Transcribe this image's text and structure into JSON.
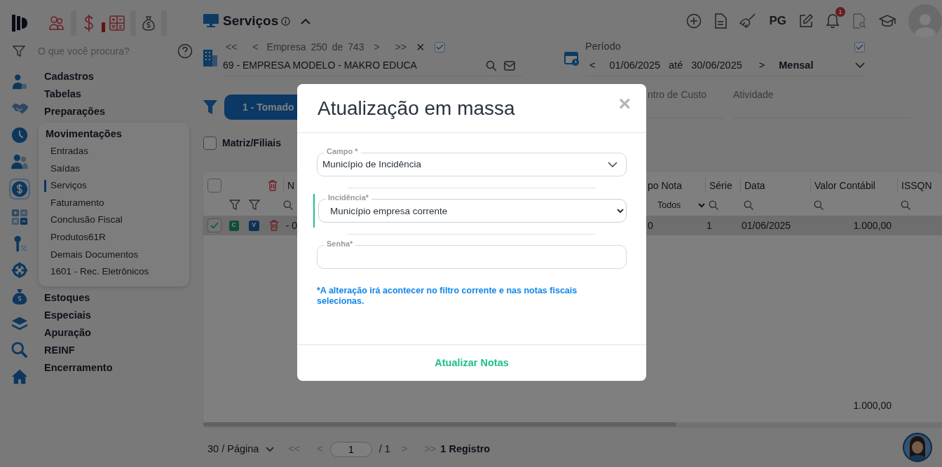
{
  "sidebar": {
    "search": {
      "placeholder": "O que você procura?"
    },
    "rail": [
      {
        "selected": false
      },
      {
        "selected": false
      },
      {
        "selected": false
      },
      {
        "selected": false
      },
      {
        "selected": true
      },
      {
        "selected": false
      },
      {
        "selected": false
      },
      {
        "selected": false
      },
      {
        "selected": false
      },
      {
        "selected": false
      },
      {
        "selected": false
      },
      {
        "selected": false
      }
    ],
    "menu": [
      {
        "label": "Cadastros",
        "expanded": false
      },
      {
        "label": "Tabelas",
        "expanded": false
      },
      {
        "label": "Preparações",
        "expanded": false
      },
      {
        "label": "Movimentações",
        "expanded": true,
        "children": [
          {
            "label": "Entradas",
            "selected": false
          },
          {
            "label": "Saídas",
            "selected": false
          },
          {
            "label": "Serviços",
            "selected": true
          },
          {
            "label": "Faturamento",
            "selected": false
          },
          {
            "label": "Conclusão Fiscal",
            "selected": false
          },
          {
            "label": "Produtos61R",
            "selected": false
          },
          {
            "label": "Demais Documentos",
            "selected": false
          },
          {
            "label": "1601 - Rec. Eletrônicos",
            "selected": false
          }
        ]
      },
      {
        "label": "Estoques",
        "expanded": false
      },
      {
        "label": "Especiais",
        "expanded": false
      },
      {
        "label": "Apuração",
        "expanded": false
      },
      {
        "label": "REINF",
        "expanded": false
      },
      {
        "label": "Encerramento",
        "expanded": false
      }
    ]
  },
  "header": {
    "title": "Serviços",
    "toolbar": {
      "pg_label": "PG",
      "notification_count": "1"
    }
  },
  "company": {
    "first": "<<",
    "prev": "<",
    "label": "Empresa",
    "index": "250",
    "of": "de",
    "total": "743",
    "next": ">",
    "last": ">>",
    "clear": "×",
    "checked": true,
    "name": "69 - EMPRESA MODELO - MAKRO EDUCA"
  },
  "period": {
    "label": "Período",
    "checked": true,
    "prev": "<",
    "from": "01/06/2025",
    "to_label": "até",
    "to": "30/06/2025",
    "next": ">",
    "mode": "Mensal"
  },
  "filters": {
    "tab_label": "1 - Tomado",
    "fields": [
      {
        "label": "ntro de Custo"
      },
      {
        "label": "Atividade"
      }
    ],
    "matriz": {
      "label": "Matriz/Filiais",
      "checked": false
    }
  },
  "table": {
    "select_all": false,
    "left_column": "N",
    "columns": [
      {
        "label": "po Nota",
        "filter": "Todos"
      },
      {
        "label": "Série"
      },
      {
        "label": "Data"
      },
      {
        "label": "Valor Contábil"
      },
      {
        "label": "ISSQN"
      }
    ],
    "rows": [
      {
        "selected": true,
        "badge_c": "C",
        "badge_v": "V",
        "left_cell": "- 0",
        "cells": [
          "0",
          "1",
          "01/06/2025",
          "1.000,00",
          ""
        ]
      }
    ],
    "total": "1.000,00"
  },
  "pagination": {
    "page_size": "30 / Página",
    "first": "<<",
    "prev": "<",
    "page": "1",
    "pages": "/ 1",
    "next": ">",
    "last": ">>",
    "count": "1 Registro"
  },
  "modal": {
    "title": "Atualização em massa",
    "close": "×",
    "fields": [
      {
        "kind": "select",
        "label": "Campo *",
        "value": "Município de Incidência",
        "active": false
      },
      {
        "kind": "native-select",
        "label": "Incidência*",
        "value": "Município empresa corrente",
        "active": true
      },
      {
        "kind": "password",
        "label": "Senha*",
        "active": false
      }
    ],
    "note": "*A alteração irá acontecer no filtro corrente e nas notas fiscais selecionas.",
    "submit": "Atualizar Notas"
  }
}
